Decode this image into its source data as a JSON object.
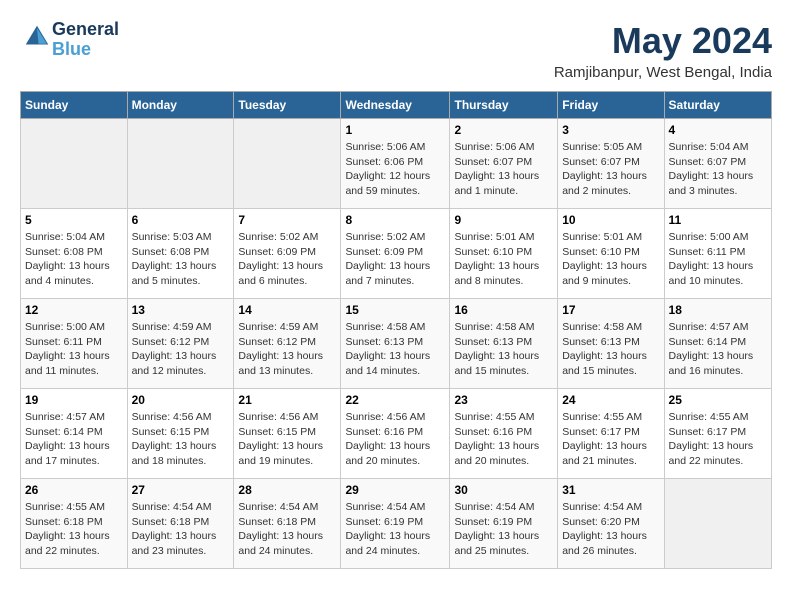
{
  "header": {
    "logo_line1": "General",
    "logo_line2": "Blue",
    "month": "May 2024",
    "location": "Ramjibanpur, West Bengal, India"
  },
  "weekdays": [
    "Sunday",
    "Monday",
    "Tuesday",
    "Wednesday",
    "Thursday",
    "Friday",
    "Saturday"
  ],
  "weeks": [
    [
      {
        "day": "",
        "info": ""
      },
      {
        "day": "",
        "info": ""
      },
      {
        "day": "",
        "info": ""
      },
      {
        "day": "1",
        "info": "Sunrise: 5:06 AM\nSunset: 6:06 PM\nDaylight: 12 hours\nand 59 minutes."
      },
      {
        "day": "2",
        "info": "Sunrise: 5:06 AM\nSunset: 6:07 PM\nDaylight: 13 hours\nand 1 minute."
      },
      {
        "day": "3",
        "info": "Sunrise: 5:05 AM\nSunset: 6:07 PM\nDaylight: 13 hours\nand 2 minutes."
      },
      {
        "day": "4",
        "info": "Sunrise: 5:04 AM\nSunset: 6:07 PM\nDaylight: 13 hours\nand 3 minutes."
      }
    ],
    [
      {
        "day": "5",
        "info": "Sunrise: 5:04 AM\nSunset: 6:08 PM\nDaylight: 13 hours\nand 4 minutes."
      },
      {
        "day": "6",
        "info": "Sunrise: 5:03 AM\nSunset: 6:08 PM\nDaylight: 13 hours\nand 5 minutes."
      },
      {
        "day": "7",
        "info": "Sunrise: 5:02 AM\nSunset: 6:09 PM\nDaylight: 13 hours\nand 6 minutes."
      },
      {
        "day": "8",
        "info": "Sunrise: 5:02 AM\nSunset: 6:09 PM\nDaylight: 13 hours\nand 7 minutes."
      },
      {
        "day": "9",
        "info": "Sunrise: 5:01 AM\nSunset: 6:10 PM\nDaylight: 13 hours\nand 8 minutes."
      },
      {
        "day": "10",
        "info": "Sunrise: 5:01 AM\nSunset: 6:10 PM\nDaylight: 13 hours\nand 9 minutes."
      },
      {
        "day": "11",
        "info": "Sunrise: 5:00 AM\nSunset: 6:11 PM\nDaylight: 13 hours\nand 10 minutes."
      }
    ],
    [
      {
        "day": "12",
        "info": "Sunrise: 5:00 AM\nSunset: 6:11 PM\nDaylight: 13 hours\nand 11 minutes."
      },
      {
        "day": "13",
        "info": "Sunrise: 4:59 AM\nSunset: 6:12 PM\nDaylight: 13 hours\nand 12 minutes."
      },
      {
        "day": "14",
        "info": "Sunrise: 4:59 AM\nSunset: 6:12 PM\nDaylight: 13 hours\nand 13 minutes."
      },
      {
        "day": "15",
        "info": "Sunrise: 4:58 AM\nSunset: 6:13 PM\nDaylight: 13 hours\nand 14 minutes."
      },
      {
        "day": "16",
        "info": "Sunrise: 4:58 AM\nSunset: 6:13 PM\nDaylight: 13 hours\nand 15 minutes."
      },
      {
        "day": "17",
        "info": "Sunrise: 4:58 AM\nSunset: 6:13 PM\nDaylight: 13 hours\nand 15 minutes."
      },
      {
        "day": "18",
        "info": "Sunrise: 4:57 AM\nSunset: 6:14 PM\nDaylight: 13 hours\nand 16 minutes."
      }
    ],
    [
      {
        "day": "19",
        "info": "Sunrise: 4:57 AM\nSunset: 6:14 PM\nDaylight: 13 hours\nand 17 minutes."
      },
      {
        "day": "20",
        "info": "Sunrise: 4:56 AM\nSunset: 6:15 PM\nDaylight: 13 hours\nand 18 minutes."
      },
      {
        "day": "21",
        "info": "Sunrise: 4:56 AM\nSunset: 6:15 PM\nDaylight: 13 hours\nand 19 minutes."
      },
      {
        "day": "22",
        "info": "Sunrise: 4:56 AM\nSunset: 6:16 PM\nDaylight: 13 hours\nand 20 minutes."
      },
      {
        "day": "23",
        "info": "Sunrise: 4:55 AM\nSunset: 6:16 PM\nDaylight: 13 hours\nand 20 minutes."
      },
      {
        "day": "24",
        "info": "Sunrise: 4:55 AM\nSunset: 6:17 PM\nDaylight: 13 hours\nand 21 minutes."
      },
      {
        "day": "25",
        "info": "Sunrise: 4:55 AM\nSunset: 6:17 PM\nDaylight: 13 hours\nand 22 minutes."
      }
    ],
    [
      {
        "day": "26",
        "info": "Sunrise: 4:55 AM\nSunset: 6:18 PM\nDaylight: 13 hours\nand 22 minutes."
      },
      {
        "day": "27",
        "info": "Sunrise: 4:54 AM\nSunset: 6:18 PM\nDaylight: 13 hours\nand 23 minutes."
      },
      {
        "day": "28",
        "info": "Sunrise: 4:54 AM\nSunset: 6:18 PM\nDaylight: 13 hours\nand 24 minutes."
      },
      {
        "day": "29",
        "info": "Sunrise: 4:54 AM\nSunset: 6:19 PM\nDaylight: 13 hours\nand 24 minutes."
      },
      {
        "day": "30",
        "info": "Sunrise: 4:54 AM\nSunset: 6:19 PM\nDaylight: 13 hours\nand 25 minutes."
      },
      {
        "day": "31",
        "info": "Sunrise: 4:54 AM\nSunset: 6:20 PM\nDaylight: 13 hours\nand 26 minutes."
      },
      {
        "day": "",
        "info": ""
      }
    ]
  ]
}
